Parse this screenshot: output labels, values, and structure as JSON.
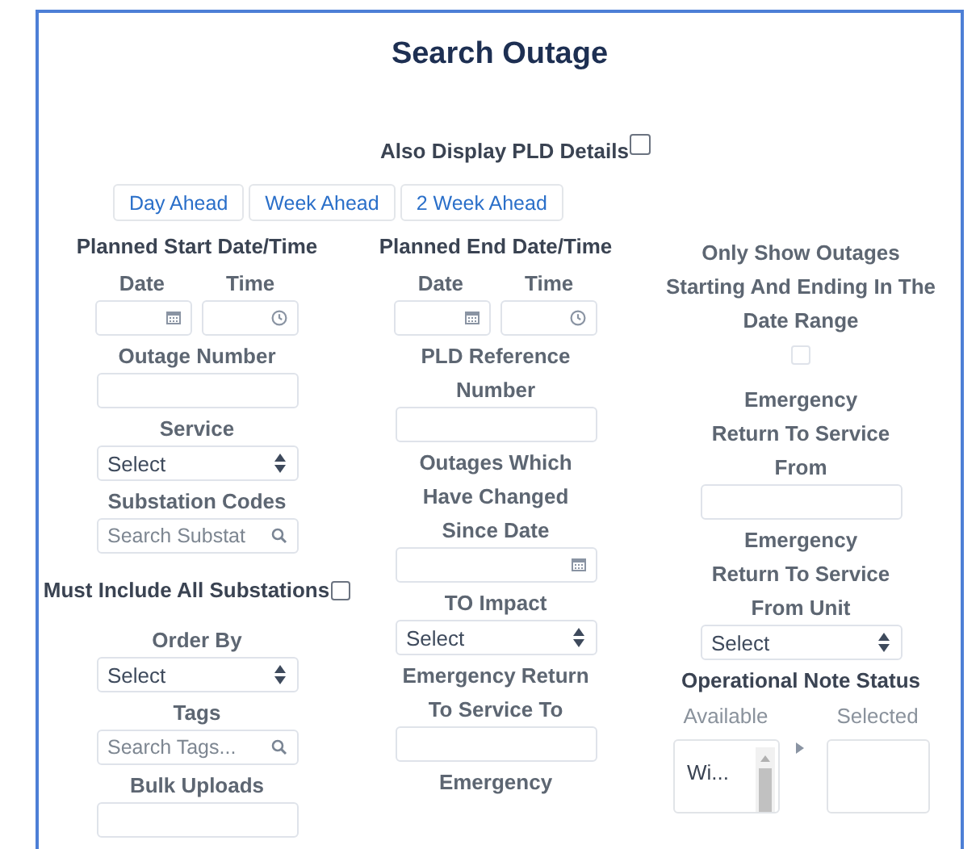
{
  "title": "Search Outage",
  "pld_details": {
    "label": "Also Display PLD Details",
    "checked": false
  },
  "range_buttons": [
    "Day Ahead",
    "Week Ahead",
    "2 Week Ahead"
  ],
  "columns": [
    {
      "items": [
        {
          "kind": "group",
          "label": "Planned Start Date/Time"
        },
        {
          "kind": "datetime",
          "date_label": "Date",
          "time_label": "Time"
        },
        {
          "kind": "text",
          "label": "Outage Number"
        },
        {
          "kind": "select",
          "label": "Service",
          "value": "Select"
        },
        {
          "kind": "search",
          "label": "Substation Codes",
          "placeholder": "Search Substat"
        },
        {
          "kind": "checkbox_inline",
          "label": "Must Include All Substations",
          "checked": false
        },
        {
          "kind": "select",
          "label": "Order By",
          "value": "Select"
        },
        {
          "kind": "search",
          "label": "Tags",
          "placeholder": "Search Tags..."
        },
        {
          "kind": "text",
          "label": "Bulk Uploads"
        }
      ]
    },
    {
      "items": [
        {
          "kind": "group",
          "label": "Planned End Date/Time"
        },
        {
          "kind": "datetime",
          "date_label": "Date",
          "time_label": "Time"
        },
        {
          "kind": "text",
          "label": "PLD Reference Number"
        },
        {
          "kind": "date",
          "label": "Outages Which Have Changed Since Date"
        },
        {
          "kind": "select",
          "label": "TO Impact",
          "value": "Select"
        },
        {
          "kind": "text",
          "label": "Emergency Return To Service To"
        },
        {
          "kind": "label",
          "label": "Emergency"
        }
      ]
    },
    {
      "items": [
        {
          "kind": "checkbox_below",
          "label": "Only Show Outages Starting And Ending In The Date Range",
          "checked": false
        },
        {
          "kind": "text",
          "label": "Emergency Return To Service From"
        },
        {
          "kind": "select",
          "label": "Emergency Return To Service From Unit",
          "value": "Select"
        },
        {
          "kind": "dual_list",
          "label": "Operational Note Status",
          "available_label": "Available",
          "selected_label": "Selected",
          "available": [
            "Wi..."
          ]
        }
      ]
    }
  ]
}
